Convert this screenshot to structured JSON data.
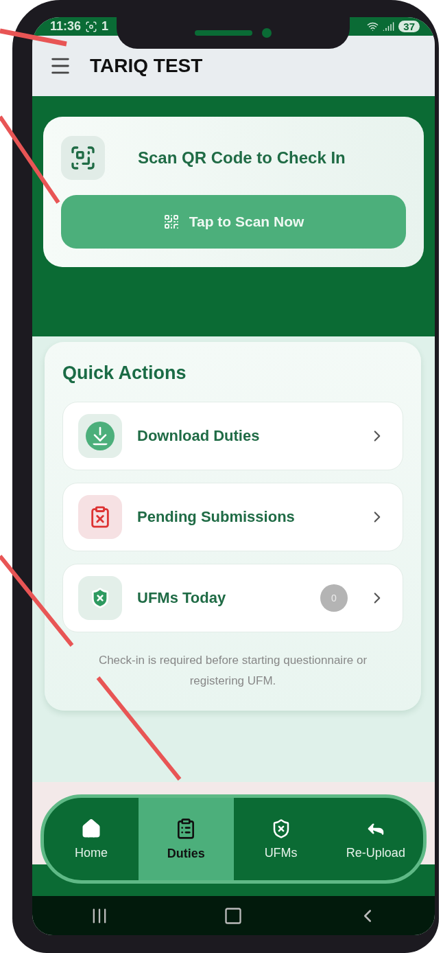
{
  "status_bar": {
    "time": "11:36",
    "notification": "1",
    "battery": "37"
  },
  "header": {
    "title": "TARIQ TEST"
  },
  "scan_card": {
    "title": "Scan QR Code to Check In",
    "button": "Tap to Scan Now"
  },
  "quick_actions": {
    "title": "Quick Actions",
    "items": [
      {
        "label": "Download Duties",
        "kind": "download"
      },
      {
        "label": "Pending Submissions",
        "kind": "pending"
      },
      {
        "label": "UFMs Today",
        "kind": "ufm",
        "badge": "0"
      }
    ],
    "note": "Check-in is required before starting questionnaire or registering UFM."
  },
  "bottom_nav": [
    {
      "label": "Home",
      "kind": "home",
      "selected": false
    },
    {
      "label": "Duties",
      "kind": "duties",
      "selected": true
    },
    {
      "label": "UFMs",
      "kind": "ufms",
      "selected": false
    },
    {
      "label": "Re-Upload",
      "kind": "reupload",
      "selected": false
    }
  ]
}
